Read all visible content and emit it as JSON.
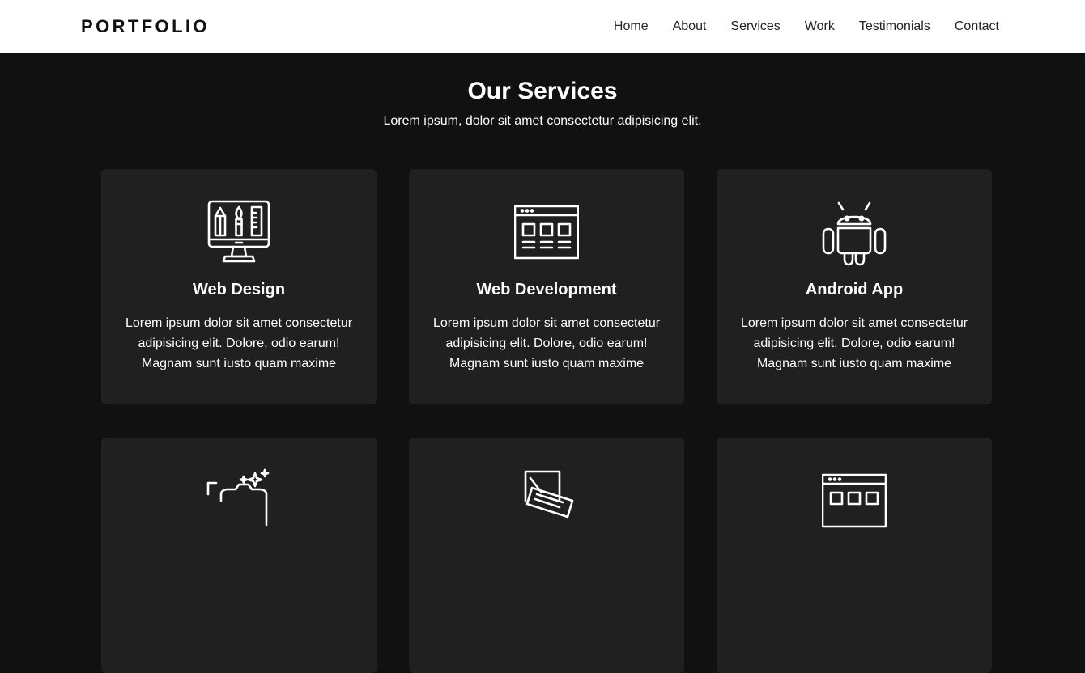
{
  "header": {
    "logo": "PORTFOLIO",
    "nav": [
      "Home",
      "About",
      "Services",
      "Work",
      "Testimonials",
      "Contact"
    ]
  },
  "services": {
    "title": "Our Services",
    "subtitle": "Lorem ipsum, dolor sit amet consectetur adipisicing elit.",
    "cards": [
      {
        "icon": "web-design-icon",
        "title": "Web Design",
        "text": "Lorem ipsum dolor sit amet consectetur adipisicing elit. Dolore, odio earum! Magnam sunt iusto quam maxime"
      },
      {
        "icon": "web-development-icon",
        "title": "Web Development",
        "text": "Lorem ipsum dolor sit amet consectetur adipisicing elit. Dolore, odio earum! Magnam sunt iusto quam maxime"
      },
      {
        "icon": "android-icon",
        "title": "Android App",
        "text": "Lorem ipsum dolor sit amet consectetur adipisicing elit. Dolore, odio earum! Magnam sunt iusto quam maxime"
      },
      {
        "icon": "photography-icon",
        "title": "",
        "text": ""
      },
      {
        "icon": "content-writing-icon",
        "title": "",
        "text": ""
      },
      {
        "icon": "browser-layout-icon",
        "title": "",
        "text": ""
      }
    ]
  }
}
